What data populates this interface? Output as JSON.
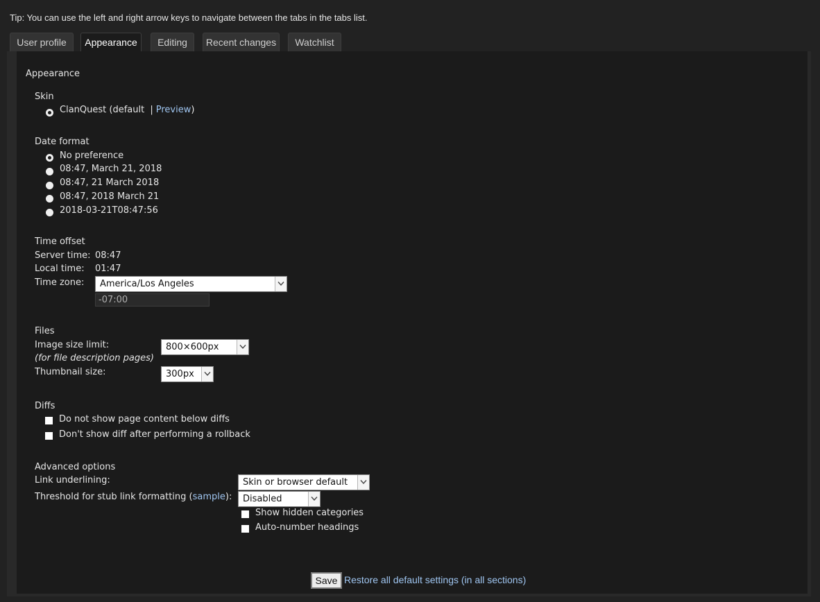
{
  "tip": "Tip: You can use the left and right arrow keys to navigate between the tabs in the tabs list.",
  "tabs": [
    {
      "label": "User profile"
    },
    {
      "label": "Appearance"
    },
    {
      "label": "Editing"
    },
    {
      "label": "Recent changes"
    },
    {
      "label": "Watchlist"
    }
  ],
  "heading": "Appearance",
  "skin": {
    "title": "Skin",
    "option": "ClanQuest (default",
    "separator": "|",
    "preview": "Preview",
    "close": ")"
  },
  "date_format": {
    "title": "Date format",
    "options": [
      "No preference",
      "08:47, March 21, 2018",
      "08:47, 21 March 2018",
      "08:47, 2018 March 21",
      "2018-03-21T08:47:56"
    ]
  },
  "time_offset": {
    "title": "Time offset",
    "server_label": "Server time:",
    "server_value": "08:47",
    "local_label": "Local time:",
    "local_value": "01:47",
    "zone_label": "Time zone:",
    "zone_value": "America/Los Angeles",
    "offset_value": "-07:00"
  },
  "files": {
    "title": "Files",
    "image_label": "Image size limit:",
    "image_note": "(for file description pages)",
    "image_value": "800×600px",
    "thumb_label": "Thumbnail size:",
    "thumb_value": "300px"
  },
  "diffs": {
    "title": "Diffs",
    "options": [
      "Do not show page content below diffs",
      "Don't show diff after performing a rollback"
    ]
  },
  "advanced": {
    "title": "Advanced options",
    "underline_label": "Link underlining:",
    "underline_value": "Skin or browser default",
    "stub_label_pre": "Threshold for stub link formatting (",
    "stub_link": "sample",
    "stub_label_post": "):",
    "stub_value": "Disabled",
    "options": [
      "Show hidden categories",
      "Auto-number headings"
    ]
  },
  "footer": {
    "save": "Save",
    "restore": "Restore all default settings (in all sections)"
  },
  "icons": {
    "dropdown": "chevron-down-icon"
  }
}
